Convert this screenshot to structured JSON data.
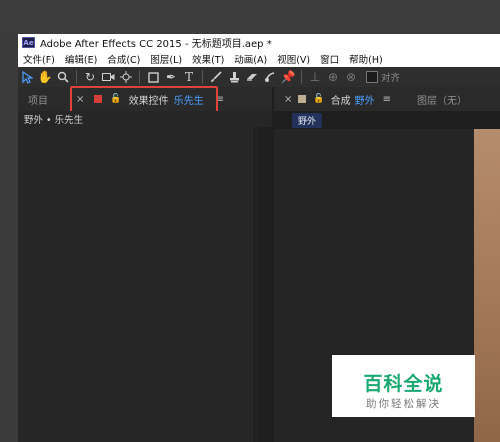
{
  "window": {
    "app_icon": "Ae",
    "title": "Adobe After Effects CC 2015 - 无标题项目.aep *"
  },
  "menubar": {
    "items": [
      "文件(F)",
      "编辑(E)",
      "合成(C)",
      "图层(L)",
      "效果(T)",
      "动画(A)",
      "视图(V)",
      "窗口",
      "帮助(H)"
    ]
  },
  "toolbar": {
    "tools": [
      "selection-tool-icon",
      "hand-tool-icon",
      "zoom-tool-icon",
      "rotate-tool-icon",
      "camera-tool-icon",
      "pan-behind-tool-icon",
      "rectangle-tool-icon",
      "pen-tool-icon",
      "type-tool-icon",
      "brush-tool-icon",
      "clone-stamp-tool-icon",
      "eraser-tool-icon",
      "roto-brush-tool-icon",
      "puppet-pin-tool-icon"
    ],
    "snap_label": "对齐"
  },
  "left_panel": {
    "project_tab": "项目",
    "effect_controls_tab": "效果控件",
    "effect_controls_layer": "乐先生",
    "breadcrumb": "野外 • 乐先生"
  },
  "right_panel": {
    "comp_tab_prefix": "合成",
    "comp_tab_name": "野外",
    "layer_tab": "图层（无）",
    "comp_pill": "野外"
  },
  "watermark": {
    "title": "百科全说",
    "subtitle": "助你轻松解决"
  },
  "colors": {
    "accent_blue": "#4aa0ff",
    "highlight_red": "#e0423c",
    "watermark_green": "#1aa874"
  }
}
